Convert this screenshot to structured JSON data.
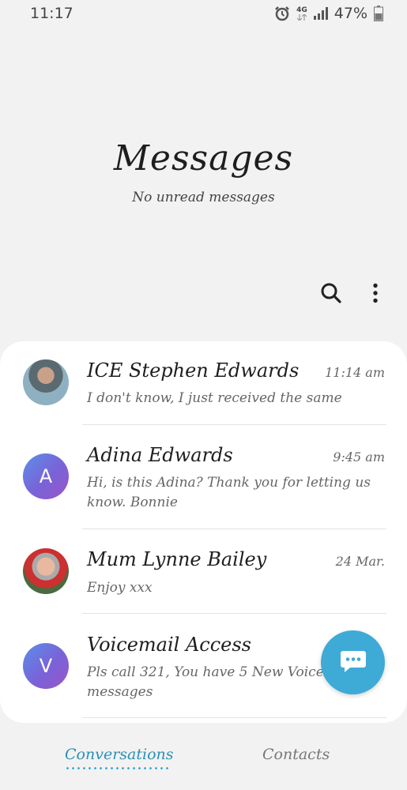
{
  "status_bar": {
    "time": "11:17",
    "network_label": "4G",
    "battery": "47%",
    "icons": [
      "alarm-icon",
      "network-4g-icon",
      "signal-icon",
      "battery-icon"
    ]
  },
  "header": {
    "title": "Messages",
    "subtitle": "No unread messages"
  },
  "toolbar": {
    "icons": [
      "search-icon",
      "more-options-icon"
    ]
  },
  "conversations": [
    {
      "name": "ICE Stephen Edwards",
      "time": "11:14 am",
      "preview": "I don't know, I just received the same",
      "avatar_type": "photo"
    },
    {
      "name": "Adina Edwards",
      "time": "9:45 am",
      "preview": "Hi, is this Adina? Thank you for letting us know. Bonnie",
      "avatar_letter": "A",
      "avatar_type": "letter"
    },
    {
      "name": "Mum Lynne Bailey",
      "time": "24 Mar.",
      "preview": "Enjoy xxx",
      "avatar_type": "photo"
    },
    {
      "name": "Voicemail Access",
      "time": "",
      "preview": "Pls call 321, You have 5 New VoiceM messages",
      "avatar_letter": "V",
      "avatar_type": "letter"
    }
  ],
  "fab": {
    "icon": "compose-message-icon"
  },
  "tabs": [
    {
      "label": "Conversations",
      "active": true
    },
    {
      "label": "Contacts",
      "active": false
    }
  ],
  "colors": {
    "accent": "#3eaad6",
    "active_tab": "#2b8fb8",
    "background": "#f2f2f2"
  }
}
